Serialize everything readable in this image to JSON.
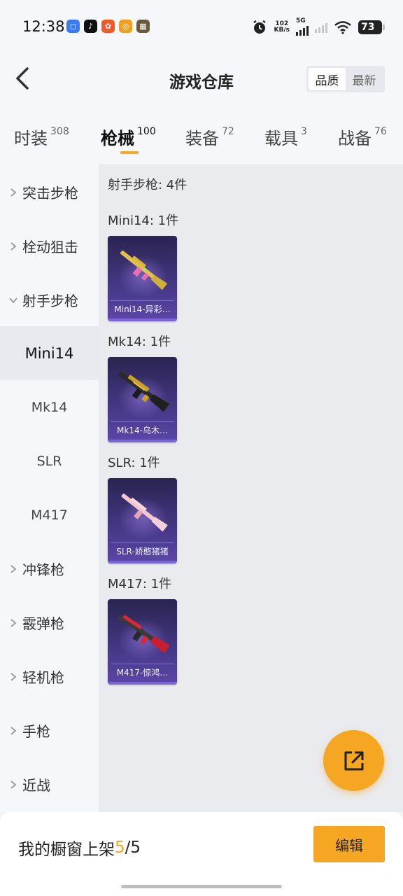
{
  "status": {
    "time": "12:38",
    "speed_value": "102",
    "speed_unit": "KB/s",
    "network": "5G",
    "battery": "73"
  },
  "header": {
    "title": "游戏仓库",
    "sort_options": [
      "品质",
      "最新"
    ],
    "sort_active": "品质"
  },
  "tabs": [
    {
      "label": "时装",
      "count": "308"
    },
    {
      "label": "枪械",
      "count": "100"
    },
    {
      "label": "装备",
      "count": "72"
    },
    {
      "label": "载具",
      "count": "3"
    },
    {
      "label": "战备",
      "count": "76"
    }
  ],
  "active_tab": "枪械",
  "sidebar": {
    "categories": [
      {
        "label": "突击步枪",
        "expanded": false
      },
      {
        "label": "栓动狙击",
        "expanded": false
      },
      {
        "label": "射手步枪",
        "expanded": true
      },
      {
        "label": "冲锋枪",
        "expanded": false
      },
      {
        "label": "霰弹枪",
        "expanded": false
      },
      {
        "label": "轻机枪",
        "expanded": false
      },
      {
        "label": "手枪",
        "expanded": false
      },
      {
        "label": "近战",
        "expanded": false
      }
    ],
    "subitems": [
      "Mini14",
      "Mk14",
      "SLR",
      "M417"
    ],
    "active_subitem": "Mini14"
  },
  "content": {
    "category_summary": "射手步枪: 4件",
    "groups": [
      {
        "header": "Mini14: 1件",
        "item_name": "Mini14-异彩…"
      },
      {
        "header": "Mk14: 1件",
        "item_name": "Mk14-乌木…"
      },
      {
        "header": "SLR: 1件",
        "item_name": "SLR-娇憨猪猪"
      },
      {
        "header": "M417: 1件",
        "item_name": "M417-惊鸿…"
      }
    ]
  },
  "bottom": {
    "showcase_label": "我的橱窗上架",
    "showcase_current": "5",
    "showcase_total": "/5",
    "edit_label": "编辑"
  },
  "icons": {
    "back": "back-arrow-icon",
    "fab": "share-external-icon"
  },
  "colors": {
    "accent": "#f5a623",
    "card_bg": "#463887"
  }
}
